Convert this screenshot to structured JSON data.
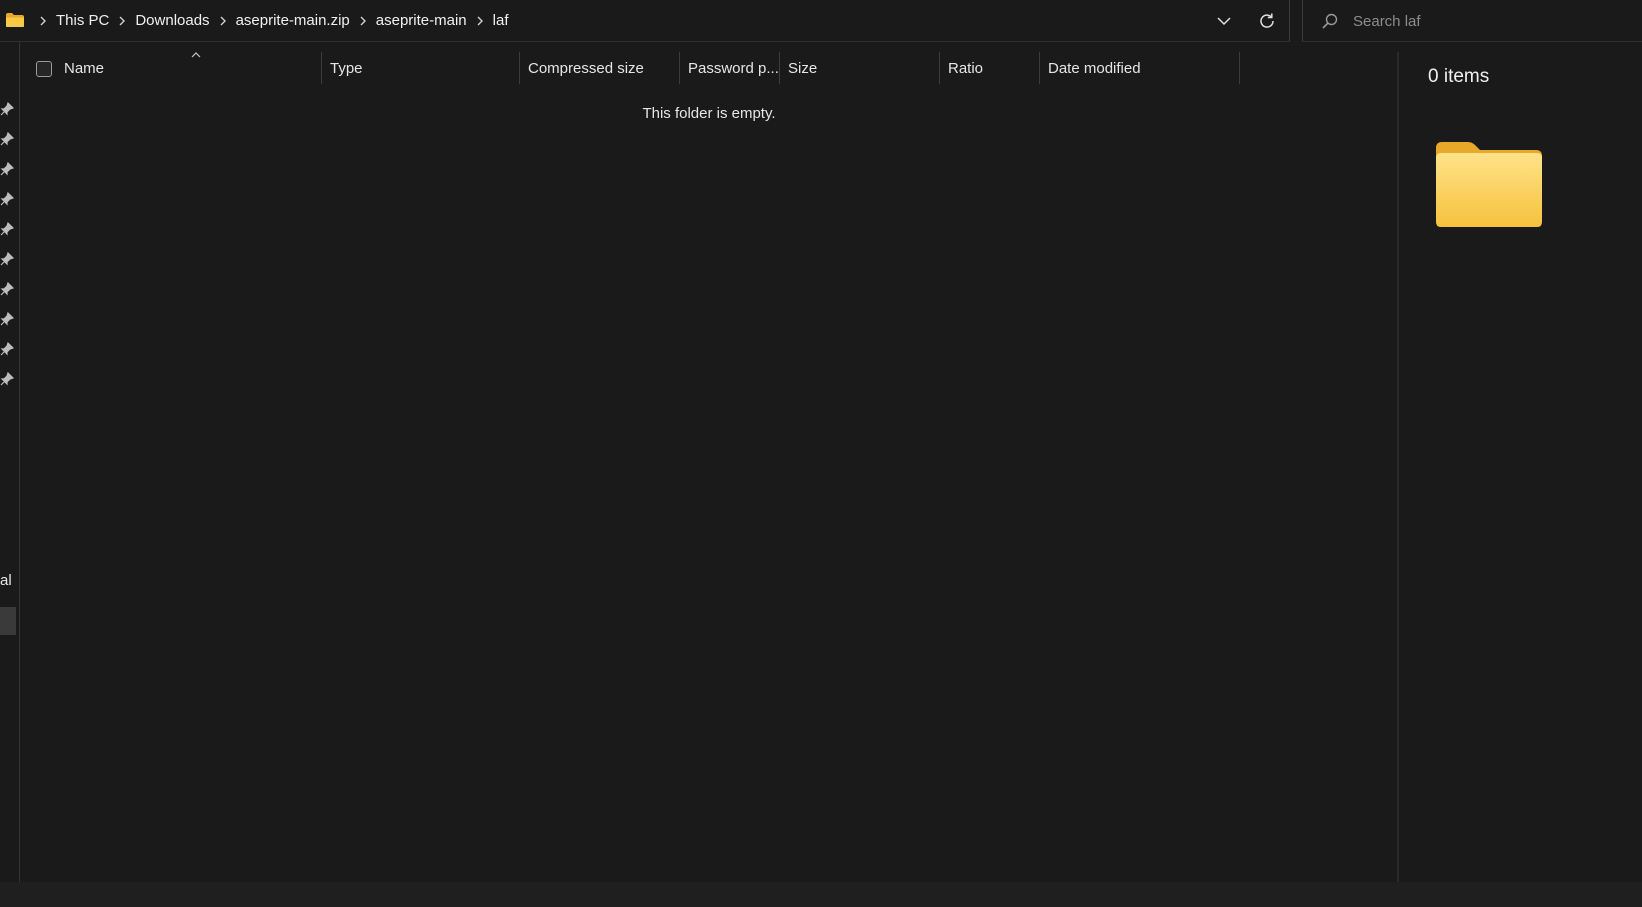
{
  "breadcrumb": {
    "items": [
      "This PC",
      "Downloads",
      "aseprite-main.zip",
      "aseprite-main",
      "laf"
    ]
  },
  "search": {
    "placeholder": "Search laf"
  },
  "columns": [
    "Name",
    "Type",
    "Compressed size",
    "Password p...",
    "Size",
    "Ratio",
    "Date modified"
  ],
  "list": {
    "empty_message": "This folder is empty."
  },
  "details": {
    "items_count": "0 items"
  },
  "nav": {
    "partial_label": "al"
  },
  "colors": {
    "folder_yellow": "#f7c948",
    "folder_dark": "#e8a92b",
    "background": "#1a1a1a"
  },
  "icons": [
    "folder-icon",
    "chevron-right-icon",
    "chevron-down-icon",
    "refresh-icon",
    "search-icon",
    "pin-icon",
    "sort-caret-icon"
  ]
}
